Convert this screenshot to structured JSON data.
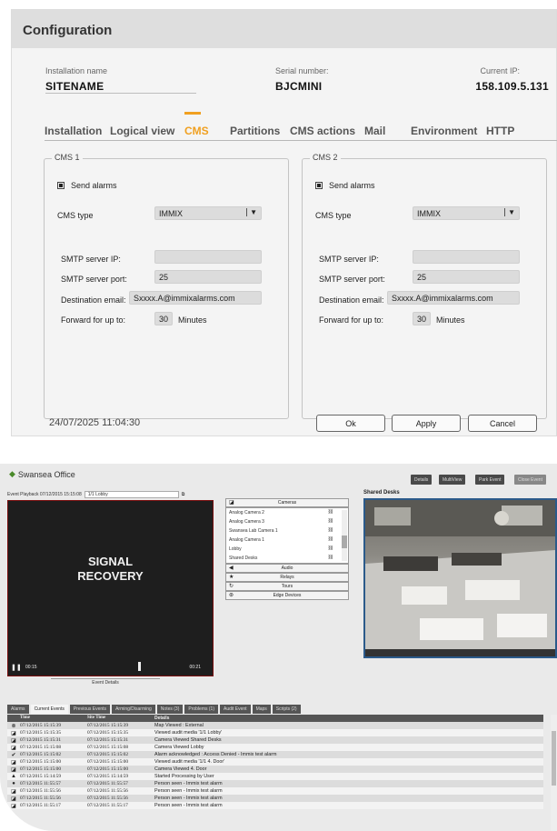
{
  "config": {
    "title": "Configuration",
    "installation": {
      "label": "Installation name",
      "value": "SITENAME"
    },
    "serial": {
      "label": "Serial number:",
      "value": "BJCMINI"
    },
    "ip": {
      "label": "Current IP:",
      "value": "158.109.5.131"
    },
    "tabs": [
      "Installation",
      "Logical view",
      "CMS",
      "Partitions",
      "CMS actions",
      "Mail",
      "Environment",
      "HTTP"
    ],
    "active_tab": "CMS",
    "cms1": {
      "title": "CMS 1",
      "send_alarms": "Send alarms",
      "cms_type_label": "CMS type",
      "cms_type_value": "IMMIX",
      "smtp_ip_label": "SMTP server IP:",
      "smtp_ip_value": "",
      "smtp_port_label": "SMTP server port:",
      "smtp_port_value": "25",
      "dest_label": "Destination email:",
      "dest_value": "Sxxxx.A@immixalarms.com",
      "forward_label": "Forward for up to:",
      "forward_value": "30",
      "forward_unit": "Minutes"
    },
    "cms2": {
      "title": "CMS 2",
      "send_alarms": "Send alarms",
      "cms_type_label": "CMS type",
      "cms_type_value": "IMMIX",
      "smtp_ip_label": "SMTP server IP:",
      "smtp_ip_value": "",
      "smtp_port_label": "SMTP server port:",
      "smtp_port_value": "25",
      "dest_label": "Destination email:",
      "dest_value": "Sxxxx.A@immixalarms.com",
      "forward_label": "Forward for up to:",
      "forward_value": "30",
      "forward_unit": "Minutes"
    },
    "timestamp": "24/07/2025  11:04:30",
    "buttons": {
      "ok": "Ok",
      "apply": "Apply",
      "cancel": "Cancel"
    }
  },
  "monitor": {
    "site": "Swansea Office",
    "top_buttons": [
      "Details",
      "MultiView",
      "Park Event",
      "Close Event"
    ],
    "playback_label": "Event Playback 07/12/2015 15:15:08",
    "playback_select": "1/1 Lobby",
    "signal_line1": "SIGNAL",
    "signal_line2": "RECOVERY",
    "time_start": "00:15",
    "time_end": "00:21",
    "event_details": "Event Details",
    "cameras_header": "Cameras",
    "cameras": [
      "Analog Camera 2",
      "Analog Camera 3",
      "Swansea Lab Camera 1",
      "Analog Camera 1",
      "Lobby",
      "Shared Desks"
    ],
    "sections": [
      "Audio",
      "Relays",
      "Tours",
      "Edge Devices"
    ],
    "shared_title": "Shared Desks",
    "tabs": [
      "Alarms",
      "Current Events",
      "Previous Events",
      "Arming/Disarming",
      "Notes (3)",
      "Problems (1)",
      "Audit Event",
      "Maps",
      "Scripts (2)"
    ],
    "active_tab": "Current Events",
    "columns": [
      "Time",
      "Site Time",
      "Details"
    ],
    "rows": [
      {
        "icon": "⊗",
        "time": "07/12/2015 15:15:39",
        "site": "07/12/2015 15:15:39",
        "details": "Map Viewed : External"
      },
      {
        "icon": "◪",
        "time": "07/12/2015 15:15:35",
        "site": "07/12/2015 15:15:35",
        "details": "Viewed audit media '1/1 Lobby'"
      },
      {
        "icon": "◪",
        "time": "07/12/2015 15:15:31",
        "site": "07/12/2015 15:15:31",
        "details": "Camera Viewed Shared Desks"
      },
      {
        "icon": "◪",
        "time": "07/12/2015 15:15:08",
        "site": "07/12/2015 15:15:08",
        "details": "Camera Viewed Lobby"
      },
      {
        "icon": "✔",
        "time": "07/12/2015 15:15:02",
        "site": "07/12/2015 15:15:02",
        "details": "Alarm acknowledged : Access Denied - Immix test alarm"
      },
      {
        "icon": "◪",
        "time": "07/12/2015 15:15:00",
        "site": "07/12/2015 15:15:00",
        "details": "Viewed audit media '1/1 4. Door'"
      },
      {
        "icon": "◪",
        "time": "07/12/2015 15:15:00",
        "site": "07/12/2015 15:15:00",
        "details": "Camera Viewed 4. Door"
      },
      {
        "icon": "▲",
        "time": "07/12/2015 15:14:59",
        "site": "07/12/2015 15:14:59",
        "details": "Started Processing by User"
      },
      {
        "icon": "●",
        "time": "07/12/2015 11:55:57",
        "site": "07/12/2015 11:55:57",
        "details": "Person seen - Immix test alarm"
      },
      {
        "icon": "◪",
        "time": "07/12/2015 11:55:56",
        "site": "07/12/2015 11:55:56",
        "details": "Person seen - Immix test alarm"
      },
      {
        "icon": "◪",
        "time": "07/12/2015 11:55:56",
        "site": "07/12/2015 11:55:56",
        "details": "Person seen - Immix test alarm"
      },
      {
        "icon": "◪",
        "time": "07/12/2015 11:55:17",
        "site": "07/12/2015 11:55:17",
        "details": "Person seen - Immix test alarm"
      }
    ]
  }
}
